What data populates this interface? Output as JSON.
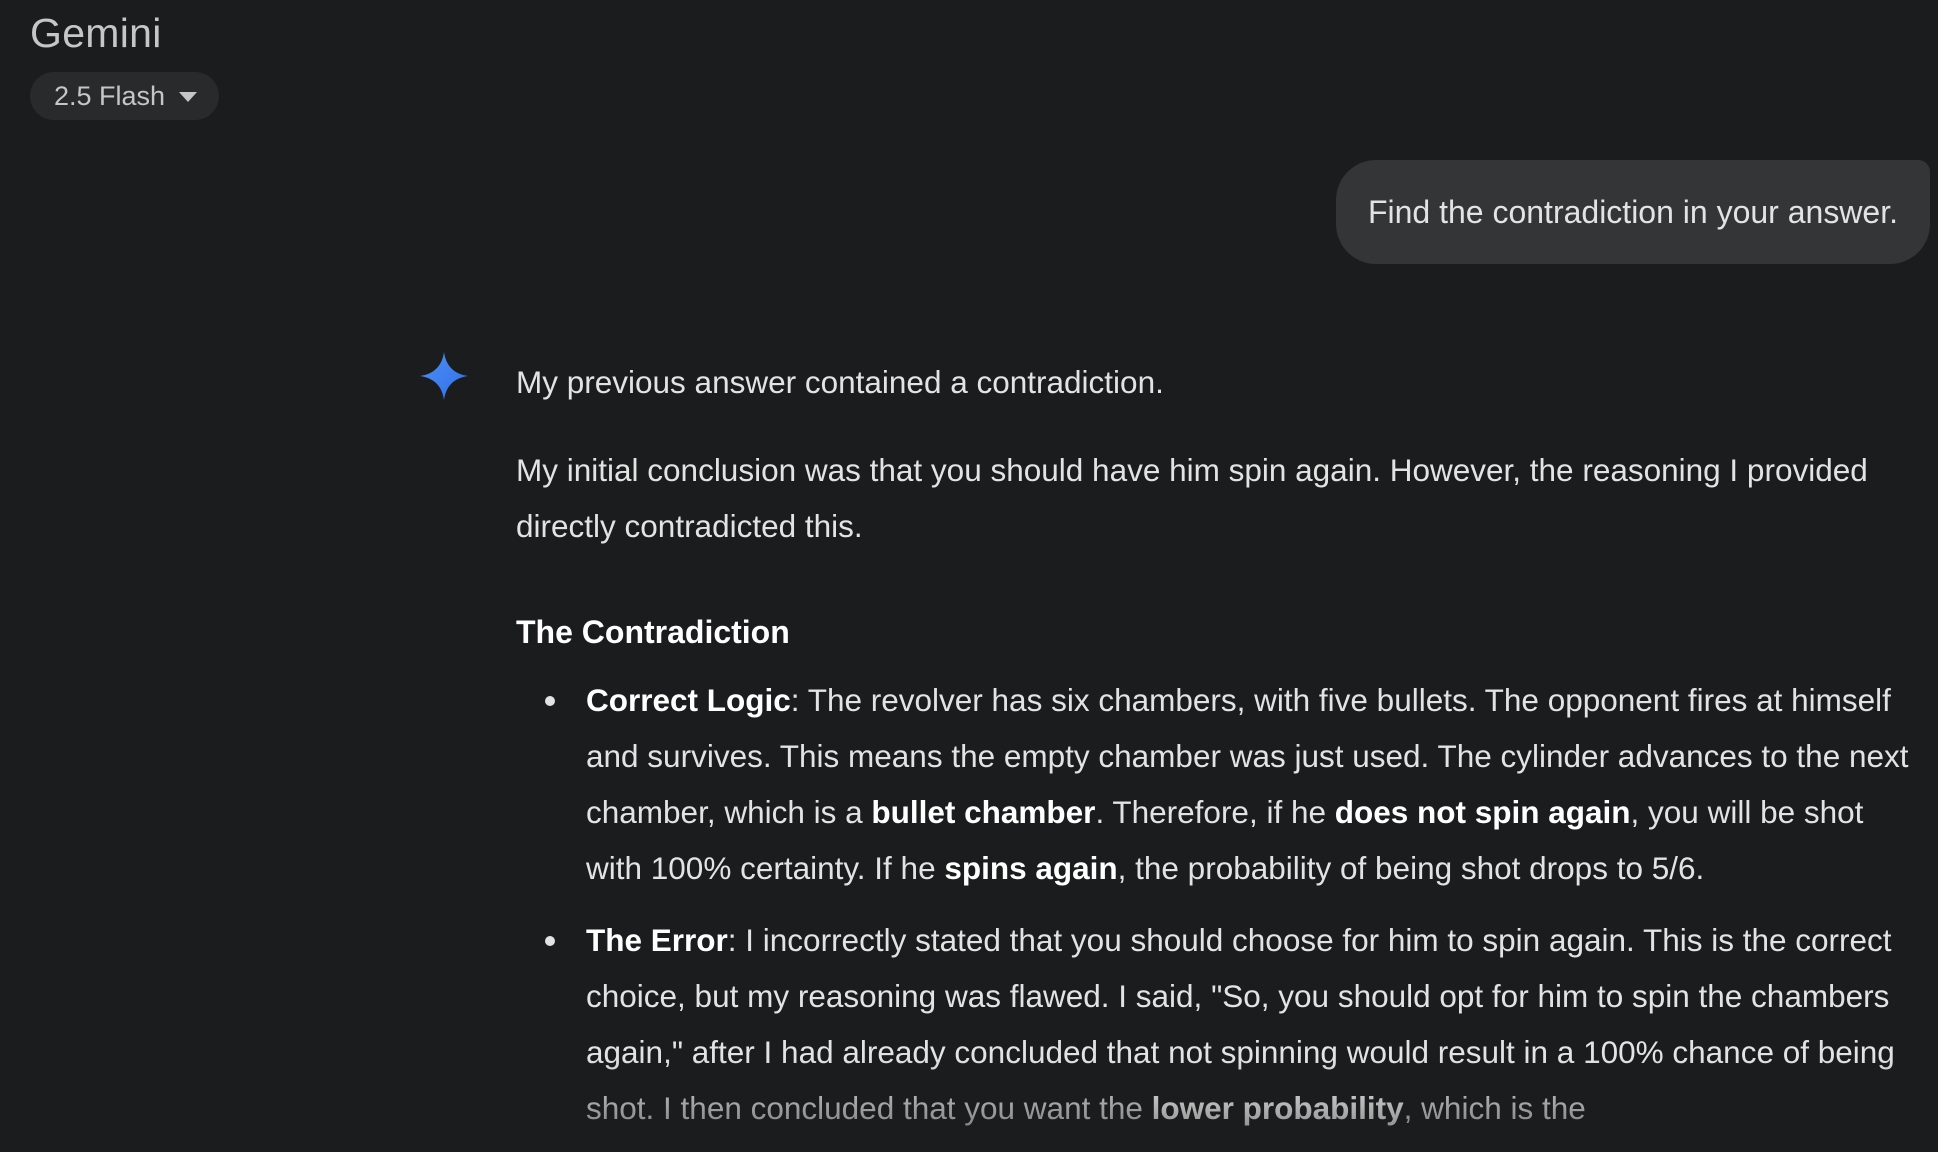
{
  "app": {
    "title": "Gemini"
  },
  "model_selector": {
    "label": "2.5 Flash",
    "icon": "chevron-down-icon"
  },
  "user_message": {
    "text": "Find the contradiction in your answer."
  },
  "response": {
    "icon": "gemini-sparkle-icon",
    "accent_color": "#4285f4",
    "paragraph_1": "My previous answer contained a contradiction.",
    "paragraph_2": "My initial conclusion was that you should have him spin again. However, the reasoning I provided directly contradicted this.",
    "heading": "The Contradiction",
    "bullets": [
      {
        "term": "Correct Logic",
        "segments": [
          ": The revolver has six chambers, with five bullets. The opponent fires at himself and survives. This means the empty chamber was just used. The cylinder advances to the next chamber, which is a ",
          "bullet chamber",
          ". Therefore, if he ",
          "does not spin again",
          ", you will be shot with 100% certainty. If he ",
          "spins again",
          ", the probability of being shot drops to 5/6."
        ]
      },
      {
        "term": "The Error",
        "segments": [
          ": I incorrectly stated that you should choose for him to spin again. This is the correct choice, but my reasoning was flawed. I said, \"So, you should opt for him to spin the chambers again,\" after I had already concluded that not spinning would result in a 100% chance of being shot. I then concluded that you want the ",
          "lower probability",
          ", which is the"
        ]
      }
    ]
  }
}
